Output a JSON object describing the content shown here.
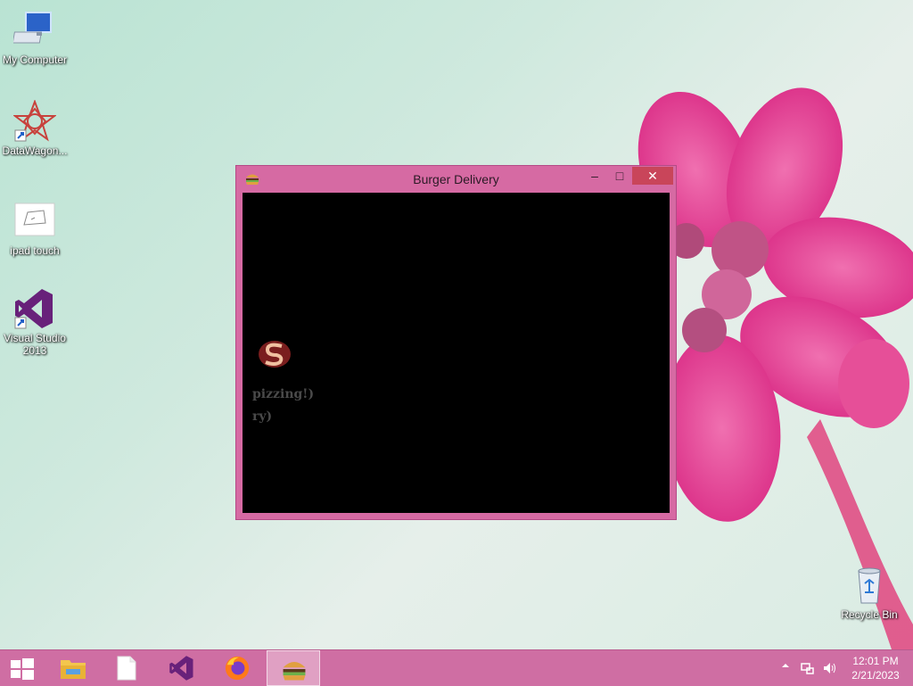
{
  "desktop": {
    "icons": [
      {
        "label": "My Computer"
      },
      {
        "label": "DataWagon..."
      },
      {
        "label": "ipad touch"
      },
      {
        "label": "Visual Studio 2013"
      },
      {
        "label": "Recycle Bin"
      }
    ]
  },
  "window": {
    "title": "Burger Delivery",
    "minimize": "–",
    "maximize": "□",
    "close": "✕",
    "game": {
      "line1": "pizzing!)",
      "line2": "ry)"
    }
  },
  "taskbar": {
    "apps": [
      "start-button",
      "file-explorer",
      "blank-document",
      "visual-studio",
      "firefox",
      "burger-delivery"
    ],
    "clock": {
      "time": "12:01 PM",
      "date": "2/21/2023"
    }
  },
  "colors": {
    "taskbar": "#cf6ea3",
    "window_frame": "#d66aa3",
    "close_button": "#c9455a"
  }
}
